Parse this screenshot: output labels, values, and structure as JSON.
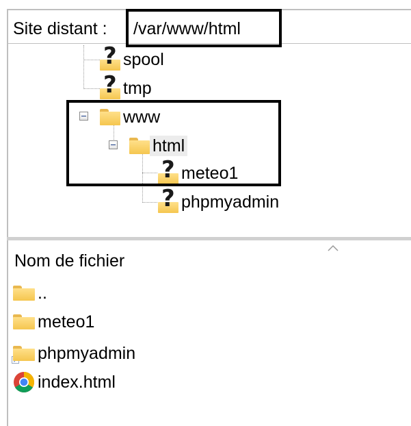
{
  "address_bar": {
    "label": "Site distant :",
    "path": "/var/www/html"
  },
  "tree": {
    "nodes": [
      {
        "label": "spool",
        "icon": "unknown-folder-icon",
        "state": "unknown"
      },
      {
        "label": "tmp",
        "icon": "unknown-folder-icon",
        "state": "unknown"
      },
      {
        "label": "www",
        "icon": "folder-icon",
        "state": "expanded"
      },
      {
        "label": "html",
        "icon": "folder-icon",
        "state": "expanded",
        "selected": true
      },
      {
        "label": "meteo1",
        "icon": "unknown-folder-icon",
        "state": "unknown"
      },
      {
        "label": "phpmyadmin",
        "icon": "unknown-folder-icon",
        "state": "unknown"
      }
    ]
  },
  "file_list": {
    "column_header": "Nom de fichier",
    "rows": [
      {
        "name": "..",
        "icon": "folder-icon"
      },
      {
        "name": "meteo1",
        "icon": "folder-icon"
      },
      {
        "name": "phpmyadmin",
        "icon": "folder-shortcut-icon"
      },
      {
        "name": "index.html",
        "icon": "chrome-html-icon"
      }
    ]
  },
  "colors": {
    "folder": "#f5c64f",
    "panel_border": "#bfbfbf",
    "highlight_border": "#000000",
    "selection": "#ececec"
  }
}
